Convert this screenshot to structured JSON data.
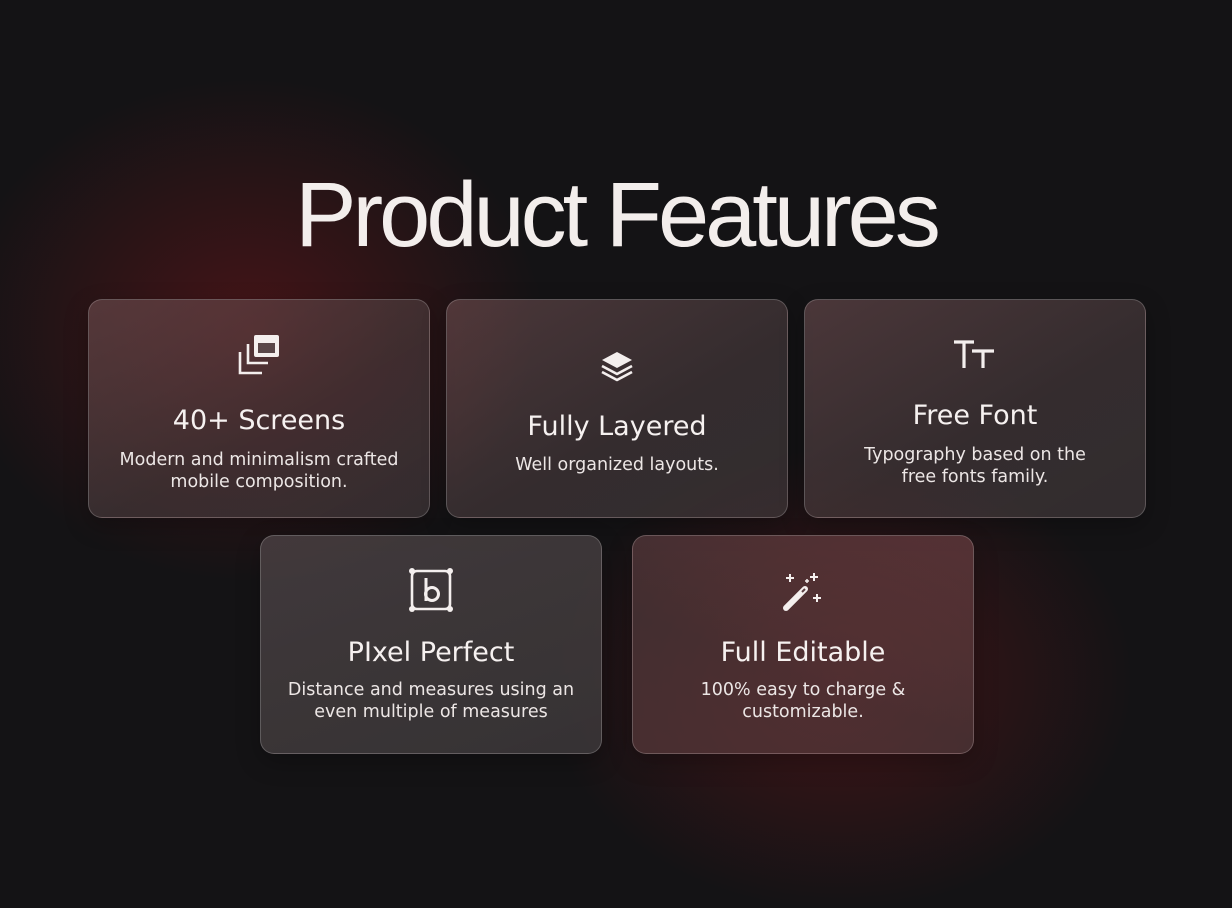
{
  "page": {
    "title": "Product Features"
  },
  "features": [
    {
      "title": "40+ Screens",
      "desc_line1": "Modern and minimalism crafted",
      "desc_line2": "mobile composition.",
      "icon": "screens-icon"
    },
    {
      "title": "Fully Layered",
      "desc_line1": "Well organized layouts.",
      "desc_line2": "",
      "icon": "layers-icon"
    },
    {
      "title": "Free Font",
      "desc_line1": "Typography based on the",
      "desc_line2": "free fonts family.",
      "icon": "text-size-icon"
    },
    {
      "title": "PIxel Perfect",
      "desc_line1": "Distance and measures using an",
      "desc_line2": "even multiple of measures",
      "icon": "bounding-box-icon"
    },
    {
      "title": "Full Editable",
      "desc_line1": "100% easy to charge &",
      "desc_line2": "customizable.",
      "icon": "magic-wand-icon"
    }
  ],
  "colors": {
    "background": "#141315",
    "glow": "#6e161a",
    "text": "#f4efee"
  }
}
